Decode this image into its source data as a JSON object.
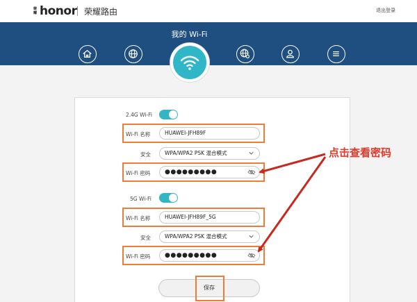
{
  "header": {
    "brand_mark": "荣耀",
    "brand_word": "honor",
    "brand_name": "荣耀路由",
    "logout": "退出登录"
  },
  "nav": {
    "title": "我的 Wi-Fi",
    "icons": [
      "home-icon",
      "globe-icon",
      "wifi-icon",
      "network-settings-icon",
      "user-icon",
      "menu-icon"
    ],
    "active": "wifi-icon"
  },
  "wifi24": {
    "label": "2.4G Wi-Fi",
    "enabled": true,
    "name_label": "Wi-Fi 名称",
    "name_value": "HUAWEI-JFH89F",
    "security_label": "安全",
    "security_value": "WPA/WPA2 PSK 混合模式",
    "password_label": "Wi-Fi 密码",
    "password_value": "●●●●●●●●●"
  },
  "wifi5": {
    "label": "5G Wi-Fi",
    "enabled": true,
    "name_label": "Wi-Fi 名称",
    "name_value": "HUAWEI-JFH89F_5G",
    "security_label": "安全",
    "security_value": "WPA/WPA2 PSK 混合模式",
    "password_label": "Wi-Fi 密码",
    "password_value": "●●●●●●●●●"
  },
  "save_label": "保存",
  "annotation": "点击查看密码",
  "colors": {
    "nav_bg": "#1e4f80",
    "accent": "#2fb7c7",
    "highlight": "#f07b36",
    "annotation": "#e23a2a"
  }
}
